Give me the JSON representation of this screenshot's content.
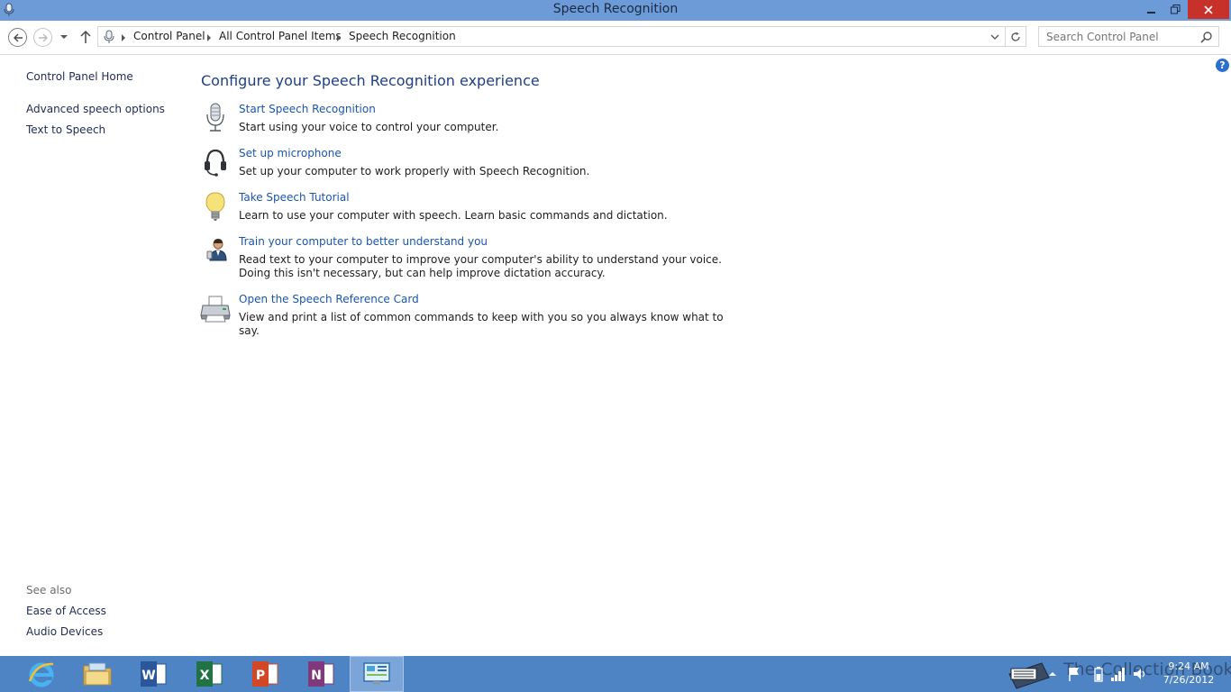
{
  "window": {
    "title": "Speech Recognition"
  },
  "address": {
    "crumbs": [
      "Control Panel",
      "All Control Panel Items",
      "Speech Recognition"
    ],
    "search_placeholder": "Search Control Panel"
  },
  "sidebar": {
    "home": "Control Panel Home",
    "items": [
      {
        "label": "Advanced speech options"
      },
      {
        "label": "Text to Speech"
      }
    ],
    "see_also_label": "See also",
    "see_also": [
      {
        "label": "Ease of Access"
      },
      {
        "label": "Audio Devices"
      }
    ]
  },
  "main": {
    "heading": "Configure your Speech Recognition experience",
    "tasks": [
      {
        "icon": "microphone-icon",
        "link": "Start Speech Recognition",
        "desc": "Start using your voice to control your computer."
      },
      {
        "icon": "headset-icon",
        "link": "Set up microphone",
        "desc": "Set up your computer to work properly with Speech Recognition."
      },
      {
        "icon": "lightbulb-icon",
        "link": "Take Speech Tutorial",
        "desc": "Learn to use your computer with speech.  Learn basic commands and dictation."
      },
      {
        "icon": "person-icon",
        "link": "Train your computer to better understand you",
        "desc": "Read text to your computer to improve your computer's ability to understand your voice.  Doing this isn't necessary, but can help improve dictation accuracy."
      },
      {
        "icon": "printer-icon",
        "link": "Open the Speech Reference Card",
        "desc": "View and print a list of common commands to keep with you so you always know what to say."
      }
    ]
  },
  "taskbar": {
    "apps": [
      "internet-explorer-icon",
      "file-explorer-icon",
      "word-icon",
      "excel-icon",
      "powerpoint-icon",
      "onenote-icon",
      "control-panel-icon"
    ],
    "time": "9:24 AM",
    "date": "7/26/2012",
    "watermark": "The Collection Book"
  },
  "colors": {
    "titlebar": "#6d9bd8",
    "close": "#c7312a",
    "link": "#1a55b0",
    "taskbar": "#4e83c4"
  }
}
